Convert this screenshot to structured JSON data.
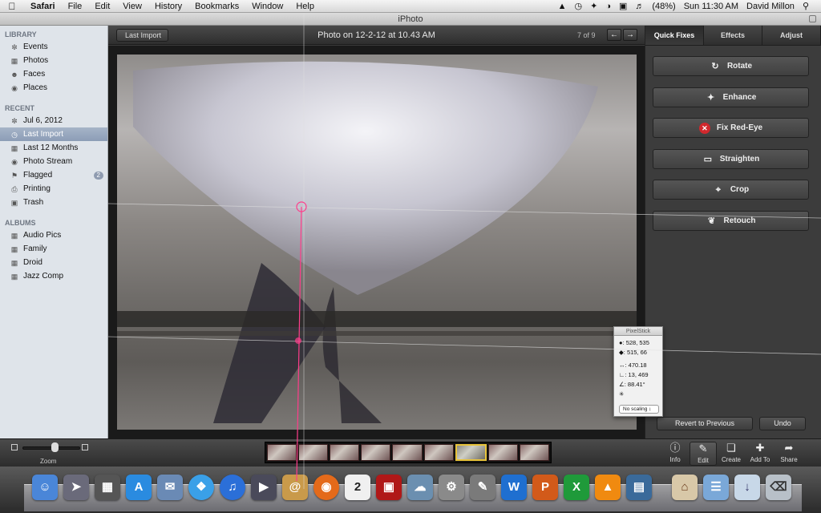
{
  "menubar": {
    "app": "Safari",
    "menus": [
      "File",
      "Edit",
      "View",
      "History",
      "Bookmarks",
      "Window",
      "Help"
    ],
    "battery": "(48%)",
    "clock": "Sun 11:30 AM",
    "user": "David Millon"
  },
  "window": {
    "title": "iPhoto"
  },
  "sidebar": {
    "library_header": "LIBRARY",
    "library": [
      "Events",
      "Photos",
      "Faces",
      "Places"
    ],
    "recent_header": "RECENT",
    "recent": [
      "Jul 6, 2012",
      "Last Import",
      "Last 12 Months",
      "Photo Stream",
      "Flagged",
      "Printing",
      "Trash"
    ],
    "flagged_count": "2",
    "albums_header": "ALBUMS",
    "albums": [
      "Audio Pics",
      "Family",
      "Droid",
      "Jazz Comp"
    ]
  },
  "topbar": {
    "back_label": "Last Import",
    "photo_title": "Photo on 12-2-12 at 10.43 AM",
    "count": "7 of 9"
  },
  "panel": {
    "tabs": [
      "Quick Fixes",
      "Effects",
      "Adjust"
    ],
    "fixes": [
      "Rotate",
      "Enhance",
      "Fix Red-Eye",
      "Straighten",
      "Crop",
      "Retouch"
    ],
    "revert_label": "Revert to Previous",
    "undo_label": "Undo"
  },
  "toolbar": {
    "zoom_label": "Zoom",
    "thumbnail_selected_index": 6,
    "buttons": [
      "Info",
      "Edit",
      "Create",
      "Add To",
      "Share"
    ]
  },
  "pixelstick": {
    "title": "PixelStick",
    "point1": ": 528, 535",
    "point2": ": 515, 66",
    "distance": ": 470.18",
    "delta": ": 13, 469",
    "angle": ": 88.41°",
    "scaling": "No scaling"
  },
  "colors": {
    "sidebar_bg": "#dfe4ea",
    "selection": "#8c9db6",
    "panel_bg": "#3c3c3c",
    "guide_pink": "#ff3d8b",
    "redeye_red": "#d0282d"
  }
}
